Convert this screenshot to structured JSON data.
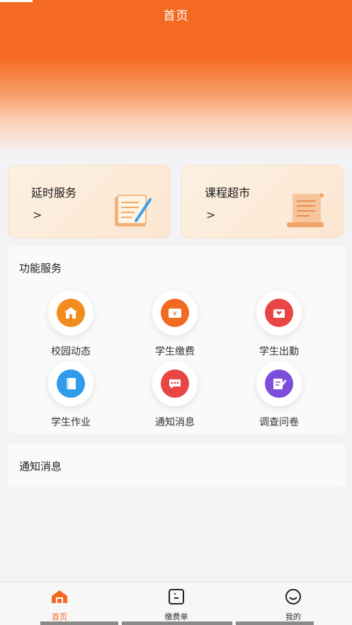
{
  "header": {
    "title": "首页"
  },
  "promos": [
    {
      "title": "延时服务",
      "arrow": ">"
    },
    {
      "title": "课程超市",
      "arrow": ">"
    }
  ],
  "functions": {
    "title": "功能服务",
    "items": [
      {
        "label": "校园动态",
        "icon": "school-icon",
        "color": "#f28c1e"
      },
      {
        "label": "学生缴费",
        "icon": "payment-icon",
        "color": "#f26a21"
      },
      {
        "label": "学生出勤",
        "icon": "attendance-icon",
        "color": "#e84545"
      },
      {
        "label": "学生作业",
        "icon": "homework-icon",
        "color": "#2f9bea"
      },
      {
        "label": "通知消息",
        "icon": "message-icon",
        "color": "#e84545"
      },
      {
        "label": "调查问卷",
        "icon": "survey-icon",
        "color": "#7c4ddb"
      }
    ]
  },
  "notice": {
    "title": "通知消息"
  },
  "tabbar": {
    "items": [
      {
        "label": "首页",
        "icon": "home-icon",
        "active": true
      },
      {
        "label": "缴费单",
        "icon": "bill-icon",
        "active": false
      },
      {
        "label": "我的",
        "icon": "profile-icon",
        "active": false
      }
    ]
  },
  "colors": {
    "accent": "#f26a21",
    "header": "#f46a22"
  }
}
